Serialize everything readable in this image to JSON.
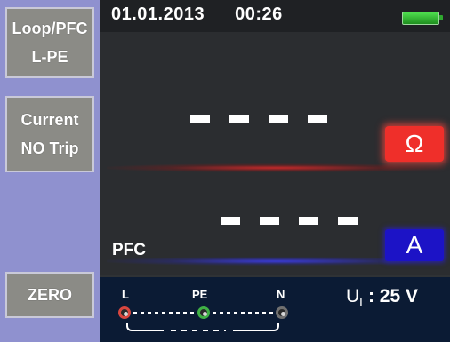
{
  "sidebar": {
    "function_line1": "Loop/PFC",
    "function_line2": "L-PE",
    "test_line1": "Current",
    "test_line2": "NO Trip",
    "zero": "ZERO"
  },
  "status": {
    "date": "01.01.2013",
    "time": "00:26",
    "battery_icon": "battery-full-icon"
  },
  "display": {
    "resistance_value": "- - - -",
    "resistance_unit": "Ω",
    "current_value": "- - - -",
    "current_unit": "A",
    "current_label": "PFC"
  },
  "terminals": {
    "l": "L",
    "pe": "PE",
    "n": "N"
  },
  "limit": {
    "symbol": "U",
    "subscript": "L",
    "value": ": 25 V"
  },
  "colors": {
    "ohm_accent": "#ef2f2a",
    "amp_accent": "#1c13c6",
    "sidebar": "#8f91cf",
    "battery": "#2fa82f"
  }
}
